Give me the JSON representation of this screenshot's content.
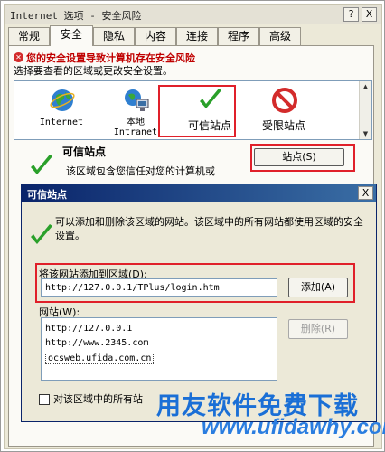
{
  "window": {
    "title": "Internet 选项 - 安全风险",
    "help_btn": "?",
    "close_btn": "X"
  },
  "tabs": [
    {
      "label": "常规"
    },
    {
      "label": "安全"
    },
    {
      "label": "隐私"
    },
    {
      "label": "内容"
    },
    {
      "label": "连接"
    },
    {
      "label": "程序"
    },
    {
      "label": "高级"
    }
  ],
  "active_tab": "安全",
  "security": {
    "warning": "您的安全设置导致计算机存在安全风险",
    "zone_prompt": "选择要查看的区域或更改安全设置。",
    "zones": [
      {
        "label": "Internet",
        "icon": "globe-icon"
      },
      {
        "label": "本地 Intranet",
        "label_line1": "本地",
        "label_line2": "Intranet",
        "icon": "network-icon"
      },
      {
        "label": "可信站点",
        "icon": "check-icon"
      },
      {
        "label": "受限站点",
        "icon": "no-entry-icon"
      }
    ],
    "selected_zone": {
      "title": "可信站点",
      "description": "该区域包含您信任对您的计算机或"
    },
    "sites_button": "站点(S)"
  },
  "trusted_dialog": {
    "title": "可信站点",
    "close_btn": "X",
    "description": "可以添加和删除该区域的网站。该区域中的所有网站都使用区域的安全设置。",
    "add_label": "将该网站添加到区域(D):",
    "url_value": "http://127.0.0.1/TPlus/login.htm",
    "add_button": "添加(A)",
    "sites_label": "网站(W):",
    "sites": [
      "http://127.0.0.1",
      "http://www.2345.com",
      "ocsweb.ufida.com.cn"
    ],
    "remove_button": "删除(R)",
    "require_label": "对该区域中的所有站"
  },
  "watermark": {
    "text": "用友软件免费下载",
    "url": "www.ufidawhy.com"
  },
  "colors": {
    "highlight": "#e0202a",
    "title_bar": "#0a246a",
    "check_green": "#2aa02a",
    "watermark_blue": "#1a6fd6"
  }
}
